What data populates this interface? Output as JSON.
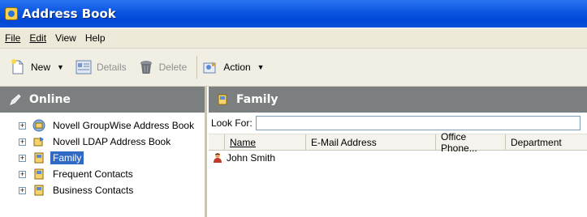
{
  "window": {
    "title": "Address Book"
  },
  "menu": [
    {
      "label": "File"
    },
    {
      "label": "Edit"
    },
    {
      "label": "View"
    },
    {
      "label": "Help"
    }
  ],
  "toolbar": {
    "new_label": "New",
    "details_label": "Details",
    "delete_label": "Delete",
    "action_label": "Action"
  },
  "left_pane": {
    "header": "Online",
    "tree": [
      {
        "label": "Novell GroupWise Address Book",
        "icon": "groupwise-book-icon"
      },
      {
        "label": "Novell LDAP Address Book",
        "icon": "ldap-book-icon"
      },
      {
        "label": "Family",
        "icon": "folder-book-icon",
        "selected": true
      },
      {
        "label": "Frequent Contacts",
        "icon": "folder-book-icon"
      },
      {
        "label": "Business Contacts",
        "icon": "folder-book-icon"
      }
    ]
  },
  "right_pane": {
    "header": "Family",
    "look_for_label": "Look For:",
    "look_for_value": "",
    "columns": [
      "Name",
      "E-Mail Address",
      "Office Phone...",
      "Department"
    ],
    "rows": [
      {
        "name": "John Smith",
        "email": "",
        "phone": "",
        "department": ""
      }
    ]
  },
  "colors": {
    "titlebar": "#0a55e0",
    "selection": "#316ac5",
    "pane_header": "#7c7f80"
  }
}
